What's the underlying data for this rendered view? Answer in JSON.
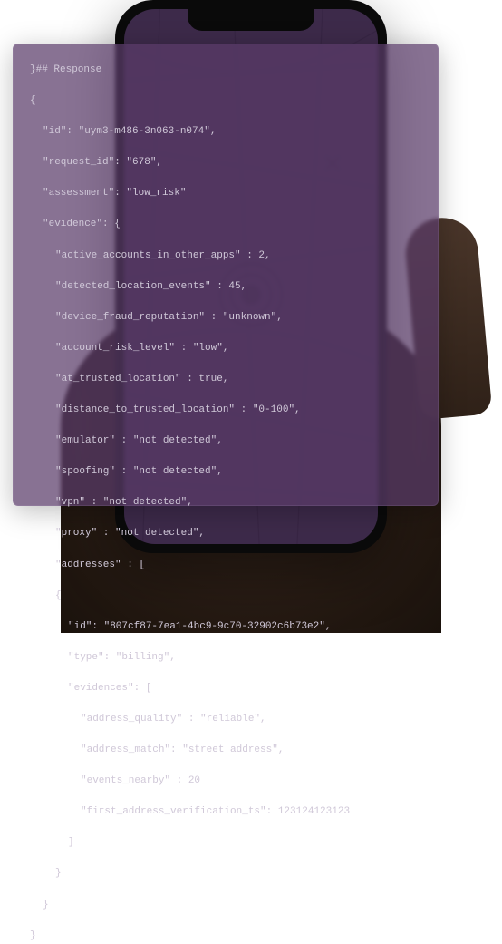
{
  "code_header": "}## Response",
  "response": {
    "id": "uym3-m486-3n063-n074",
    "request_id": "678",
    "assessment": "low_risk",
    "evidence": {
      "active_accounts_in_other_apps": 2,
      "detected_location_events": 45,
      "device_fraud_reputation": "unknown",
      "account_risk_level": "low",
      "at_trusted_location": true,
      "distance_to_trusted_location": "0-100",
      "emulator": "not detected",
      "spoofing": "not detected",
      "vpn": "not detected",
      "proxy": "not detected",
      "addresses": [
        {
          "id": "807cf87-7ea1-4bc9-9c70-32902c6b73e2",
          "type": "billing",
          "evidences": {
            "address_quality": "reliable",
            "address_match": "street address",
            "events_nearby": 20,
            "first_address_verification_ts": 123124123123
          }
        }
      ]
    }
  },
  "lines": {
    "l0": "}## Response",
    "l1": "{",
    "l2": "\"id\": \"uym3-m486-3n063-n074\",",
    "l3": "\"request_id\": \"678\",",
    "l4": "\"assessment\": \"low_risk\"",
    "l5": "\"evidence\": {",
    "l6": "\"active_accounts_in_other_apps\" : 2,",
    "l7": "\"detected_location_events\" : 45,",
    "l8": "\"device_fraud_reputation\" : \"unknown\",",
    "l9": "\"account_risk_level\" : \"low\",",
    "l10": "\"at_trusted_location\" : true,",
    "l11": "\"distance_to_trusted_location\" : \"0-100\",",
    "l12": "\"emulator\" : \"not detected\",",
    "l13": "\"spoofing\" : \"not detected\",",
    "l14": "\"vpn\" : \"not detected\",",
    "l15": "\"proxy\" : \"not detected\",",
    "l16": "\"addresses\" : [",
    "l17": "{",
    "l18": "\"id\": \"807cf87-7ea1-4bc9-9c70-32902c6b73e2\",",
    "l19": "\"type\": \"billing\",",
    "l20": "\"evidences\": [",
    "l21": "\"address_quality\" : \"reliable\",",
    "l22": "\"address_match\": \"street address\",",
    "l23": "\"events_nearby\" : 20",
    "l24": "\"first_address_verification_ts\": 123124123123",
    "l25": "]",
    "l26": "}",
    "l27": "}",
    "l28": "}"
  }
}
